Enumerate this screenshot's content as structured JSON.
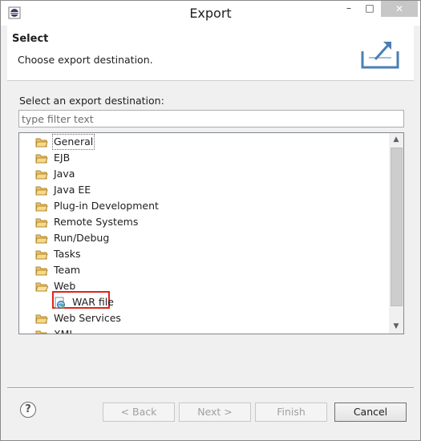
{
  "window": {
    "title": "Export",
    "minimize_glyph": "–",
    "maximize_glyph": "□",
    "close_glyph": "✕"
  },
  "banner": {
    "title": "Select",
    "description": "Choose export destination.",
    "icon": "export-wizard-icon"
  },
  "content": {
    "prompt": "Select an export destination:",
    "filter_placeholder": "type filter text",
    "filter_value": ""
  },
  "tree": {
    "items": [
      {
        "label": "General",
        "icon": "folder-icon",
        "focused": true
      },
      {
        "label": "EJB",
        "icon": "folder-icon"
      },
      {
        "label": "Java",
        "icon": "folder-icon"
      },
      {
        "label": "Java EE",
        "icon": "folder-icon"
      },
      {
        "label": "Plug-in Development",
        "icon": "folder-icon"
      },
      {
        "label": "Remote Systems",
        "icon": "folder-icon"
      },
      {
        "label": "Run/Debug",
        "icon": "folder-icon"
      },
      {
        "label": "Tasks",
        "icon": "folder-icon"
      },
      {
        "label": "Team",
        "icon": "folder-icon"
      },
      {
        "label": "Web",
        "icon": "folder-open-icon",
        "expanded": true
      },
      {
        "label": "WAR file",
        "icon": "war-file-icon",
        "child": true,
        "highlighted": true
      },
      {
        "label": "Web Services",
        "icon": "folder-icon"
      },
      {
        "label": "XML",
        "icon": "folder-icon"
      }
    ],
    "highlight_color": "#e0241b"
  },
  "footer": {
    "help_glyph": "?",
    "back_label": "< Back",
    "next_label": "Next >",
    "finish_label": "Finish",
    "cancel_label": "Cancel"
  }
}
